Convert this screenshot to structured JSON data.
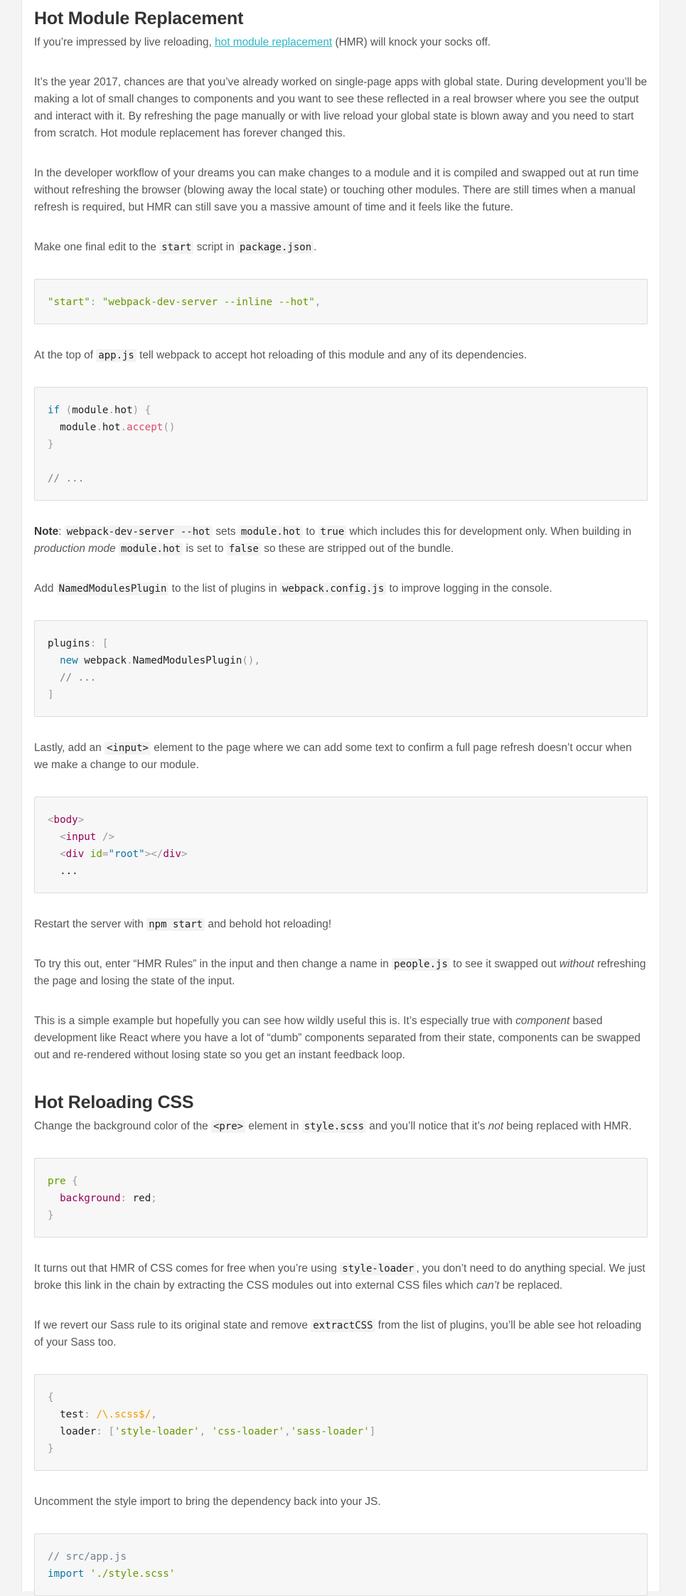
{
  "section1": {
    "title": "Hot Module Replacement",
    "intro_before": "If you’re impressed by live reloading, ",
    "intro_link": "hot module replacement",
    "intro_after": " (HMR) will knock your socks off.",
    "para1": "It’s the year 2017, chances are that you’ve already worked on single-page apps with global state. During development you’ll be making a lot of small changes to components and you want to see these reflected in a real browser where you see the output and interact with it. By refreshing the page manually or with live reload your global state is blown away and you need to start from scratch. Hot module replacement has forever changed this.",
    "para2": "In the developer workflow of your dreams you can make changes to a module and it is compiled and swapped out at run time without refreshing the browser (blowing away the local state) or touching other modules. There are still times when a manual refresh is required, but HMR can still save you a massive amount of time and it feels like the future.",
    "edit_a": "Make one final edit to the ",
    "edit_code1": "start",
    "edit_b": " script in ",
    "edit_code2": "package.json",
    "edit_c": ".",
    "code1": {
      "key": "\"start\"",
      "colon": ": ",
      "value": "\"webpack-dev-server --inline --hot\"",
      "comma": ","
    },
    "top_a": "At the top of ",
    "top_code": "app.js",
    "top_b": " tell webpack to accept hot reloading of this module and any of its dependencies.",
    "code2": {
      "if": "if",
      "open": " (",
      "module": "module",
      "dot": ".",
      "hot": "hot",
      "close": ") {",
      "accept": "accept",
      "parens": "()",
      "brace": "}",
      "comment": "// ..."
    },
    "note_label": "Note",
    "note_a": ": ",
    "note_code1": "webpack-dev-server --hot",
    "note_b": " sets ",
    "note_code2": "module.hot",
    "note_c": " to ",
    "note_code3": "true",
    "note_d": " which includes this for development only. When building in ",
    "note_em": "production mode",
    "note_e": " ",
    "note_code4": "module.hot",
    "note_f": " is set to ",
    "note_code5": "false",
    "note_g": " so these are stripped out of the bundle.",
    "add_a": "Add ",
    "add_code1": "NamedModulesPlugin",
    "add_b": " to the list of plugins in ",
    "add_code2": "webpack.config.js",
    "add_c": " to improve logging in the console.",
    "code3": {
      "plugins": "plugins",
      "colon_bracket": ": [",
      "new": "new",
      "webpack": "webpack",
      "dot": ".",
      "plugin": "NamedModulesPlugin",
      "call": "(),",
      "comment": "// ...",
      "close": "]"
    },
    "last_a": "Lastly, add an ",
    "last_code": "<input>",
    "last_b": " element to the page where we can add some text to confirm a full page refresh doesn’t occur when we make a change to our module.",
    "code4": {
      "lt": "<",
      "body": "body",
      "gt": ">",
      "input": "input",
      "selfclose": " />",
      "div": "div",
      "id": "id",
      "eq": "=",
      "q": "\"",
      "root": "root",
      "endopen": "></",
      "ellipsis": "..."
    },
    "restart_a": "Restart the server with ",
    "restart_code": "npm start",
    "restart_b": " and behold hot reloading!",
    "try_a": "To try this out, enter “HMR Rules” in the input and then change a name in ",
    "try_code": "people.js",
    "try_b": " to see it swapped out ",
    "try_em": "without",
    "try_c": " refreshing the page and losing the state of the input.",
    "simple_a": "This is a simple example but hopefully you can see how wildly useful this is. It’s especially true with ",
    "simple_em": "component",
    "simple_b": " based development like React where you have a lot of “dumb” components separated from their state, components can be swapped out and re-rendered without losing state so you get an instant feedback loop."
  },
  "section2": {
    "title": "Hot Reloading CSS",
    "change_a": "Change the background color of the ",
    "change_code1": "<pre>",
    "change_b": " element in ",
    "change_code2": "style.scss",
    "change_c": " and you’ll notice that it’s ",
    "change_em": "not",
    "change_d": " being replaced with HMR.",
    "code5": {
      "pre": "pre",
      "open": " {",
      "background": "background",
      "colon": ": ",
      "red": "red",
      "semi": ";",
      "close": "}"
    },
    "turns_a": "It turns out that HMR of CSS comes for free when you’re using ",
    "turns_code": "style-loader",
    "turns_b": ", you don’t need to do anything special. We just broke this link in the chain by extracting the CSS modules out into external CSS files which ",
    "turns_em": "can’t",
    "turns_c": " be replaced.",
    "revert_a": "If we revert our Sass rule to its original state and remove ",
    "revert_code": "extractCSS",
    "revert_b": " from the list of plugins, you’ll be able see hot reloading of your Sass too.",
    "code6": {
      "open": "{",
      "test": "test",
      "colon": ": ",
      "regex": "/\\.scss$/",
      "comma": ",",
      "loader": "loader",
      "bracket_open": "[",
      "style": "'style-loader'",
      "sep": ", ",
      "css": "'css-loader'",
      "sep2": ",",
      "sass": "'sass-loader'",
      "bracket_close": "]",
      "close": "}"
    },
    "uncomment": "Uncomment the style import to bring the dependency back into your JS.",
    "code7": {
      "comment": "// src/app.js",
      "import": "import",
      "space": " ",
      "path": "'./style.scss'"
    }
  }
}
